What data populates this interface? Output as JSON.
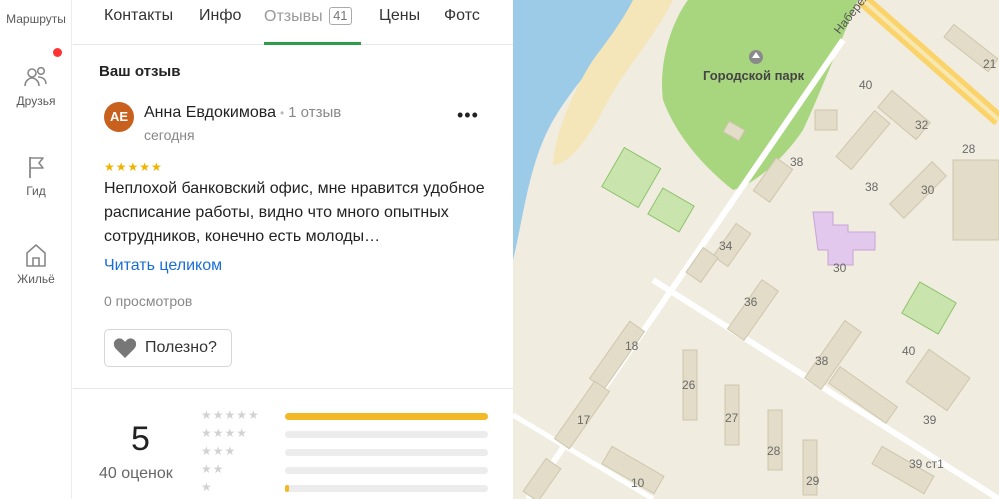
{
  "rail": {
    "items": [
      {
        "label": "Маршруты"
      },
      {
        "label": "Друзья"
      },
      {
        "label": "Гид"
      },
      {
        "label": "Жильё"
      }
    ]
  },
  "tabs": [
    {
      "label": "Контакты"
    },
    {
      "label": "Инфо"
    },
    {
      "label": "Отзывы",
      "count": "41",
      "active": true
    },
    {
      "label": "Цены"
    },
    {
      "label": "Фотс"
    }
  ],
  "own_review": {
    "title": "Ваш отзыв",
    "avatar_initials": "АЕ",
    "author": "Анна Евдокимова",
    "author_reviews": "1 отзыв",
    "date": "сегодня",
    "stars": "★★★★★",
    "text": "Неплохой банковский офис, мне нравится удобное расписание работы, видно что много опытных сотрудников, конечно есть молоды…",
    "read_more": "Читать целиком",
    "views": "0 просмотров",
    "useful_label": "Полезно?"
  },
  "summary": {
    "rating": "5",
    "count_label": "40 оценок",
    "rows": [
      {
        "stars": "★★★★★",
        "share": 1.0
      },
      {
        "stars": "★★★★",
        "share": 0.0
      },
      {
        "stars": "★★★",
        "share": 0.0
      },
      {
        "stars": "★★",
        "share": 0.0
      },
      {
        "stars": "★",
        "share": 0.02
      }
    ]
  },
  "map": {
    "park": "Городской парк",
    "street": "Набереж",
    "numbers": [
      "40",
      "21",
      "32",
      "28",
      "38",
      "38",
      "30",
      "34",
      "30",
      "36",
      "40",
      "38",
      "18",
      "26",
      "17",
      "27",
      "39",
      "28",
      "10",
      "29",
      "39 ст1"
    ]
  },
  "colors": {
    "accent_green": "#2c9e4a",
    "link_blue": "#1a6dd8",
    "star_yellow": "#f0b400",
    "bar_yellow": "#f3b825",
    "badge_red": "#ff3333"
  }
}
